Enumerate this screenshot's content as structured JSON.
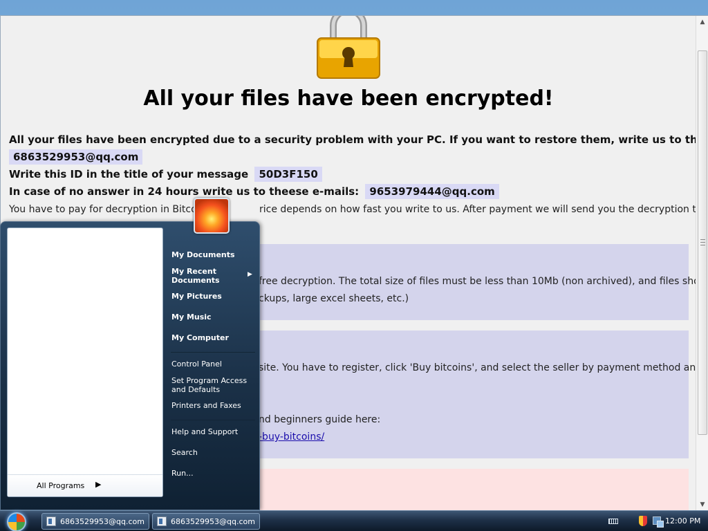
{
  "page": {
    "headline": "All your files have been encrypted!",
    "line1": "All your files have been encrypted due to a security problem with your PC. If you want to restore them, write us to the e-mail",
    "email1": "6863529953@qq.com",
    "line2_label": "Write this ID in the title of your message",
    "id": "50D3F150",
    "line3_label": "In case of no answer in 24 hours write us to theese e-mails:",
    "email2": "9653979444@qq.com",
    "line4_left": "You have to pay for decryption in Bitcoin",
    "line4_right": "rice depends on how fast you write to us. After payment we will send you the decryption tool that will",
    "panel1_line1": "free decryption. The total size of files must be less than 10Mb (non archived), and files should",
    "panel1_line2": "ckups, large excel sheets, etc.)",
    "panel2_line1": "site. You have to register, click 'Buy bitcoins', and select the seller by payment method and",
    "panel2_line2": "nd beginners guide here:",
    "panel2_link": "-buy-bitcoins/"
  },
  "start_menu": {
    "all_programs": "All Programs",
    "items": [
      "My Documents",
      "My Recent Documents",
      "My Pictures",
      "My Music",
      "My Computer",
      "Control Panel",
      "Set Program Access and Defaults",
      "Printers and Faxes",
      "Help and Support",
      "Search",
      "Run..."
    ],
    "recent_line1": "My Recent",
    "recent_line2": "Documents",
    "spa_line1": "Set Program Access",
    "spa_line2": "and Defaults"
  },
  "taskbar": {
    "buttons": [
      "6863529953@qq.com",
      "6863529953@qq.com"
    ],
    "clock": "12:00 PM"
  },
  "colors": {
    "highlight": "#d9d9f5",
    "panel": "#d4d4ec",
    "panel_alert": "#fde2e2",
    "padlock": "#f5b800"
  },
  "icons": [
    "padlock-icon",
    "user-picture",
    "start-orb-icon",
    "keyboard-icon",
    "security-shield-icon",
    "network-icon"
  ]
}
